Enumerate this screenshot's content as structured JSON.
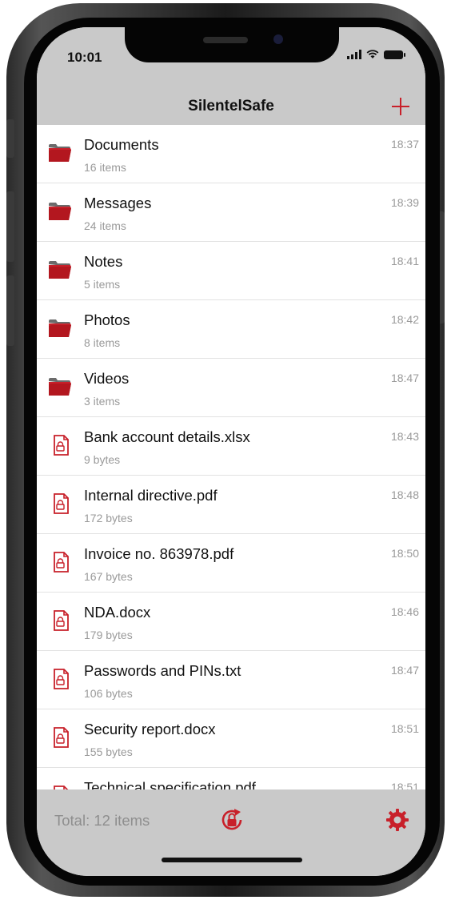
{
  "status_bar": {
    "time": "10:01"
  },
  "nav": {
    "title": "SilentelSafe",
    "add_icon": "plus-icon"
  },
  "colors": {
    "accent": "#c8202a",
    "bar_gray": "#c9c9c9",
    "secondary_text": "#9a9a9a"
  },
  "items": [
    {
      "type": "folder",
      "name": "Documents",
      "sub": "16 items",
      "time": "18:37"
    },
    {
      "type": "folder",
      "name": "Messages",
      "sub": "24 items",
      "time": "18:39"
    },
    {
      "type": "folder",
      "name": "Notes",
      "sub": "5 items",
      "time": "18:41"
    },
    {
      "type": "folder",
      "name": "Photos",
      "sub": "8 items",
      "time": "18:42"
    },
    {
      "type": "folder",
      "name": "Videos",
      "sub": "3 items",
      "time": "18:47"
    },
    {
      "type": "file",
      "name": "Bank account details.xlsx",
      "sub": "9 bytes",
      "time": "18:43"
    },
    {
      "type": "file",
      "name": "Internal directive.pdf",
      "sub": "172 bytes",
      "time": "18:48"
    },
    {
      "type": "file",
      "name": "Invoice no. 863978.pdf",
      "sub": "167 bytes",
      "time": "18:50"
    },
    {
      "type": "file",
      "name": "NDA.docx",
      "sub": "179 bytes",
      "time": "18:46"
    },
    {
      "type": "file",
      "name": "Passwords and PINs.txt",
      "sub": "106 bytes",
      "time": "18:47"
    },
    {
      "type": "file",
      "name": "Security report.docx",
      "sub": "155 bytes",
      "time": "18:51"
    },
    {
      "type": "file",
      "name": "Technical specification.pdf",
      "sub": "",
      "time": "18:51"
    }
  ],
  "footer": {
    "total_label": "Total: 12 items",
    "lock_icon": "lock-rotate-icon",
    "settings_icon": "gear-icon"
  }
}
